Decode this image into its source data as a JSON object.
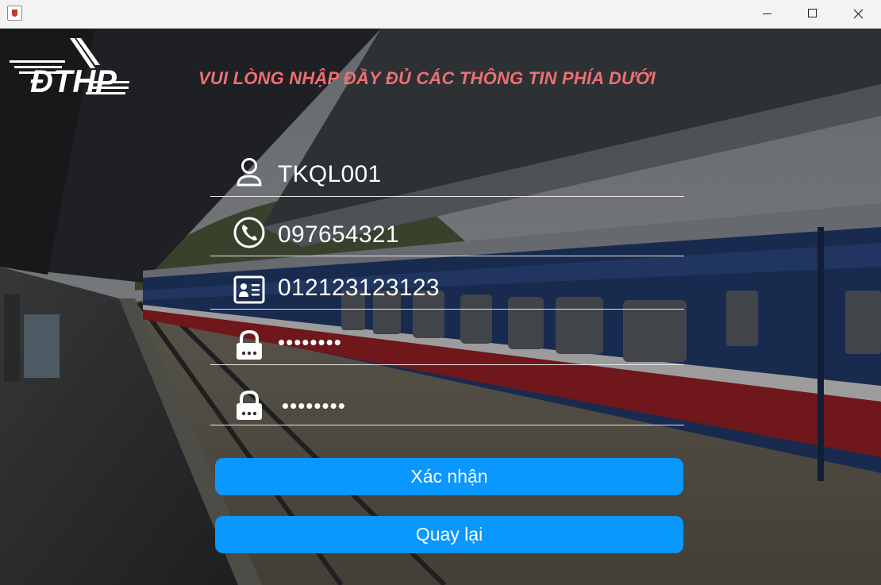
{
  "window": {
    "controls": {
      "minimize_icon": "minimize-icon",
      "maximize_icon": "maximize-icon",
      "close_icon": "close-icon"
    }
  },
  "logo": {
    "text": "ĐTHP"
  },
  "headline": "VUI LÒNG NHẬP ĐẦY ĐỦ CÁC THÔNG TIN PHÍA DƯỚI",
  "form": {
    "username": {
      "icon": "user-icon",
      "value": "TKQL001"
    },
    "phone": {
      "icon": "phone-icon",
      "value": "097654321"
    },
    "id_number": {
      "icon": "id-card-icon",
      "value": "012123123123"
    },
    "password": {
      "icon": "lock-icon",
      "value": "••••••••"
    },
    "confirm_password": {
      "icon": "lock-icon",
      "value": "••••••••"
    }
  },
  "buttons": {
    "confirm": "Xác nhận",
    "back": "Quay lại"
  },
  "colors": {
    "headline": "#ee6f73",
    "button": "#0a97ff",
    "text": "#ffffff"
  }
}
